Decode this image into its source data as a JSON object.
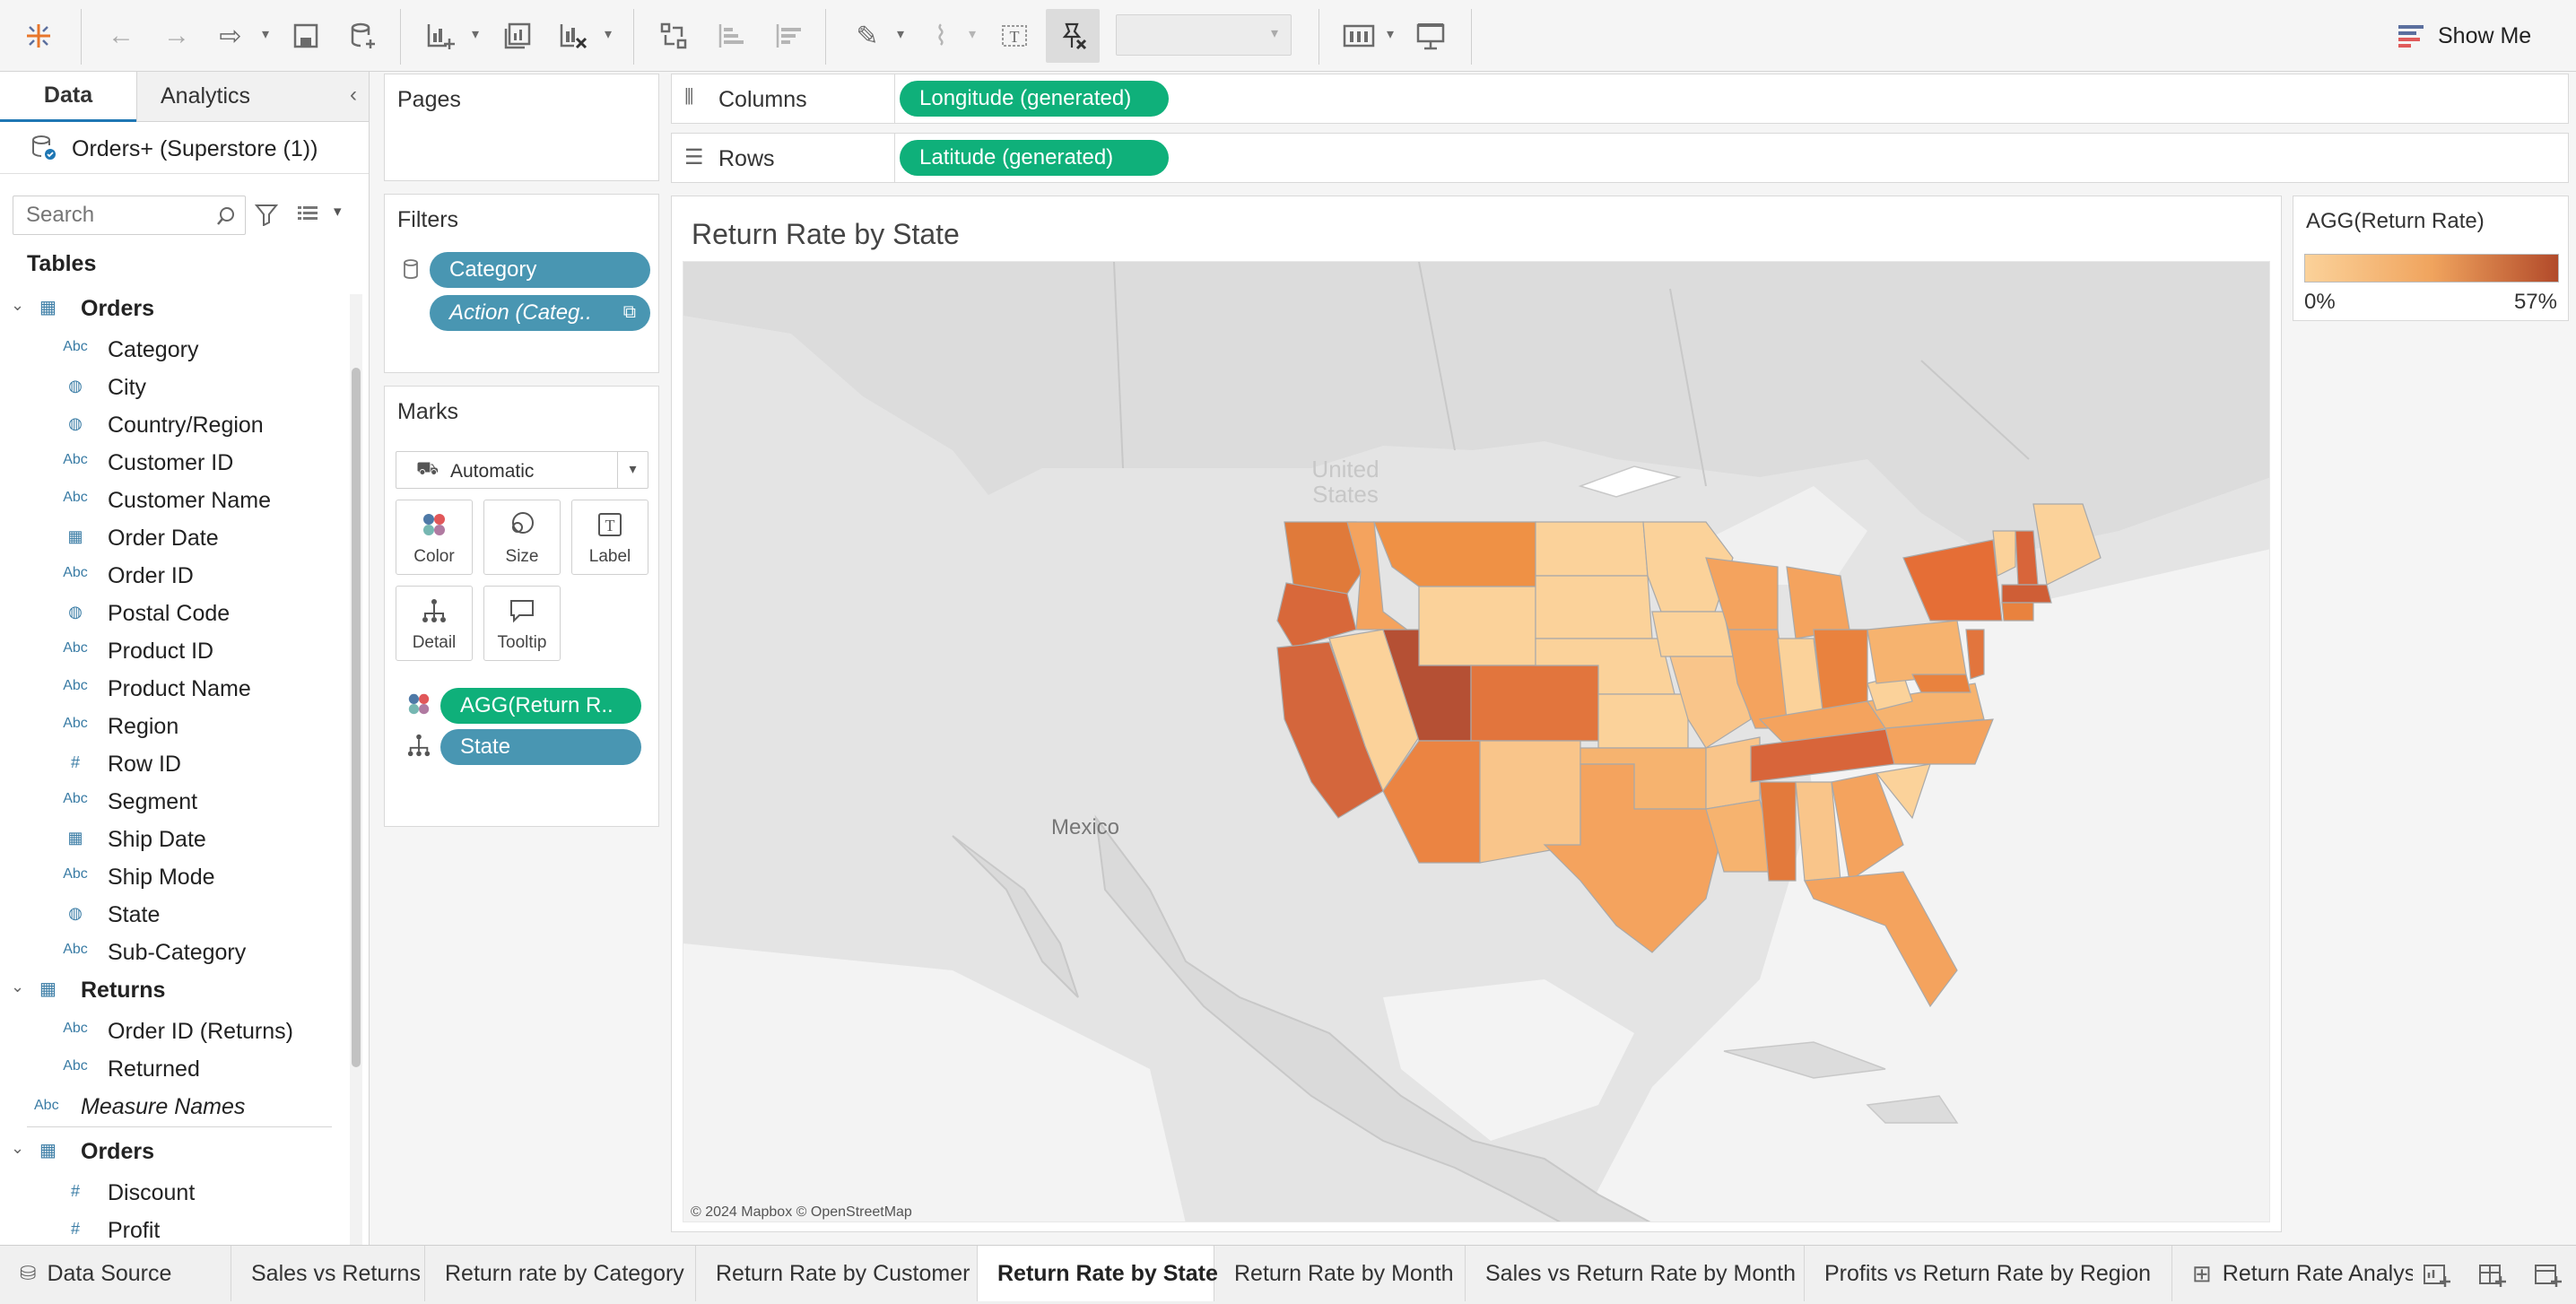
{
  "toolbar": {
    "show_me_label": "Show Me"
  },
  "data_pane": {
    "tabs": [
      "Data",
      "Analytics"
    ],
    "datasource": "Orders+ (Superstore (1))",
    "search_placeholder": "Search",
    "tables_heading": "Tables",
    "groups": [
      {
        "name": "Orders",
        "fields": [
          {
            "type": "Abc",
            "name": "Category"
          },
          {
            "type": "geo",
            "name": "City"
          },
          {
            "type": "geo",
            "name": "Country/Region"
          },
          {
            "type": "Abc",
            "name": "Customer ID"
          },
          {
            "type": "Abc",
            "name": "Customer Name"
          },
          {
            "type": "date",
            "name": "Order Date"
          },
          {
            "type": "Abc",
            "name": "Order ID"
          },
          {
            "type": "geo",
            "name": "Postal Code"
          },
          {
            "type": "Abc",
            "name": "Product ID"
          },
          {
            "type": "Abc",
            "name": "Product Name"
          },
          {
            "type": "Abc",
            "name": "Region"
          },
          {
            "type": "#",
            "name": "Row ID"
          },
          {
            "type": "Abc",
            "name": "Segment"
          },
          {
            "type": "date",
            "name": "Ship Date"
          },
          {
            "type": "Abc",
            "name": "Ship Mode"
          },
          {
            "type": "geo",
            "name": "State"
          },
          {
            "type": "Abc",
            "name": "Sub-Category"
          }
        ]
      },
      {
        "name": "Returns",
        "fields": [
          {
            "type": "Abc",
            "name": "Order ID (Returns)"
          },
          {
            "type": "Abc",
            "name": "Returned"
          }
        ]
      }
    ],
    "measure_names": "Measure Names",
    "measures_group": {
      "name": "Orders",
      "fields": [
        {
          "type": "#",
          "name": "Discount"
        },
        {
          "type": "#",
          "name": "Profit"
        }
      ]
    }
  },
  "shelves": {
    "pages_label": "Pages",
    "filters_label": "Filters",
    "filters": [
      "Category",
      "Action (Categ.."
    ],
    "marks_label": "Marks",
    "mark_type": "Automatic",
    "mark_buttons": [
      "Color",
      "Size",
      "Label",
      "Detail",
      "Tooltip"
    ],
    "mark_pills": [
      "AGG(Return R..",
      "State"
    ],
    "columns_label": "Columns",
    "columns_pill": "Longitude (generated)",
    "rows_label": "Rows",
    "rows_pill": "Latitude (generated)"
  },
  "view": {
    "title": "Return Rate by State",
    "map_labels": {
      "us_line1": "United",
      "us_line2": "States",
      "mexico": "Mexico"
    },
    "attribution": "© 2024 Mapbox © OpenStreetMap"
  },
  "legend": {
    "title": "AGG(Return Rate)",
    "min_label": "0%",
    "max_label": "57%",
    "color_low": "#fbd29a",
    "color_high": "#b24a2a"
  },
  "sheet_tabs": [
    {
      "label": "Data Source",
      "active": false
    },
    {
      "label": "Sales vs Returns",
      "active": false
    },
    {
      "label": "Return rate by Category",
      "active": false
    },
    {
      "label": "Return Rate by Customer",
      "active": false
    },
    {
      "label": "Return Rate by State",
      "active": true
    },
    {
      "label": "Return Rate by Month",
      "active": false
    },
    {
      "label": "Sales vs Return Rate by Month",
      "active": false
    },
    {
      "label": "Profits vs Return Rate by Region",
      "active": false
    },
    {
      "label": "Return Rate Analysis",
      "active": false
    }
  ]
}
